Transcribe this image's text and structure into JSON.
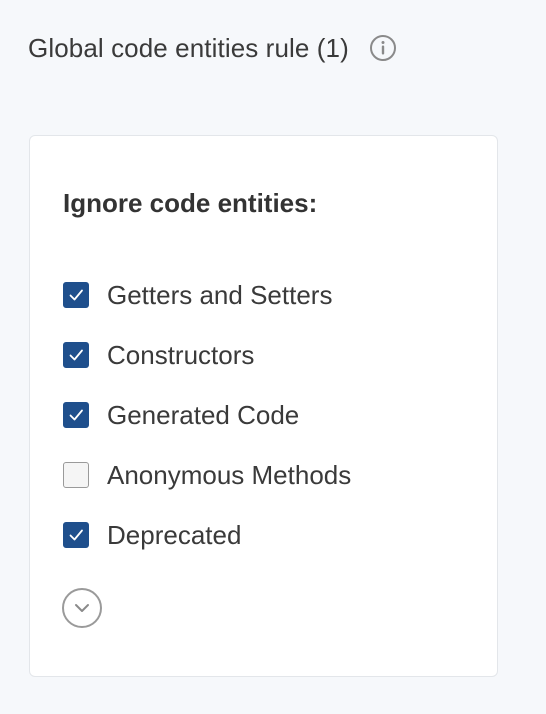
{
  "header": {
    "title": "Global code entities rule (1)",
    "info_icon": "info-circle-icon"
  },
  "card": {
    "heading": "Ignore code entities:",
    "options": [
      {
        "label": "Getters and Setters",
        "checked": true
      },
      {
        "label": "Constructors",
        "checked": true
      },
      {
        "label": "Generated Code",
        "checked": true
      },
      {
        "label": "Anonymous Methods",
        "checked": false
      },
      {
        "label": "Deprecated",
        "checked": true
      }
    ],
    "expand_icon": "chevron-down-circle-icon"
  },
  "colors": {
    "checkbox_checked": "#1f4f8c",
    "page_background": "#f6f8fb",
    "card_background": "#ffffff"
  }
}
